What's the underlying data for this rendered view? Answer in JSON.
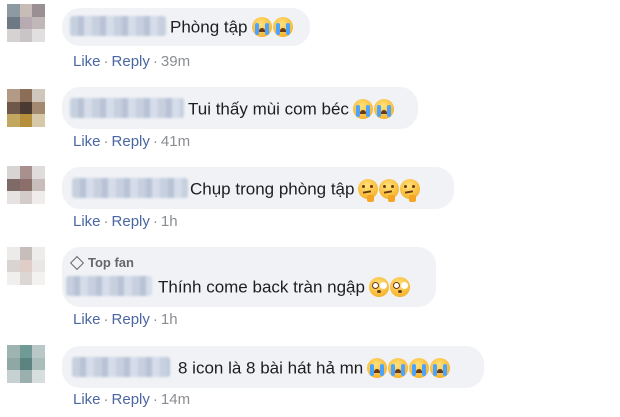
{
  "comments": [
    {
      "text": "Phòng tập",
      "emojis": [
        "crying-face-emoji",
        "crying-face-emoji"
      ],
      "like": "Like",
      "reply": "Reply",
      "time": "39m",
      "top_fan": ""
    },
    {
      "text": "Tui thấy mùi com béc",
      "emojis": [
        "crying-face-emoji",
        "crying-face-emoji"
      ],
      "like": "Like",
      "reply": "Reply",
      "time": "41m",
      "top_fan": ""
    },
    {
      "text": "Chụp trong phòng tập",
      "emojis": [
        "thinking-face-emoji",
        "thinking-face-emoji",
        "thinking-face-emoji"
      ],
      "like": "Like",
      "reply": "Reply",
      "time": "1h",
      "top_fan": ""
    },
    {
      "text": "Thính come back tràn ngập",
      "emojis": [
        "flushed-face-emoji",
        "flushed-face-emoji"
      ],
      "like": "Like",
      "reply": "Reply",
      "time": "1h",
      "top_fan": "Top fan"
    },
    {
      "text": "8 icon là 8 bài hát hả mn",
      "emojis": [
        "crying-face-emoji",
        "crying-face-emoji",
        "crying-face-emoji",
        "crying-face-emoji"
      ],
      "like": "Like",
      "reply": "Reply",
      "time": "14m",
      "top_fan": ""
    }
  ],
  "colors": {
    "bubble": "#f0f2f5",
    "link": "#4b67a1",
    "meta": "#8a8d91",
    "text": "#1c1e21"
  },
  "separator": "·",
  "diamond_icon": "diamond-icon"
}
